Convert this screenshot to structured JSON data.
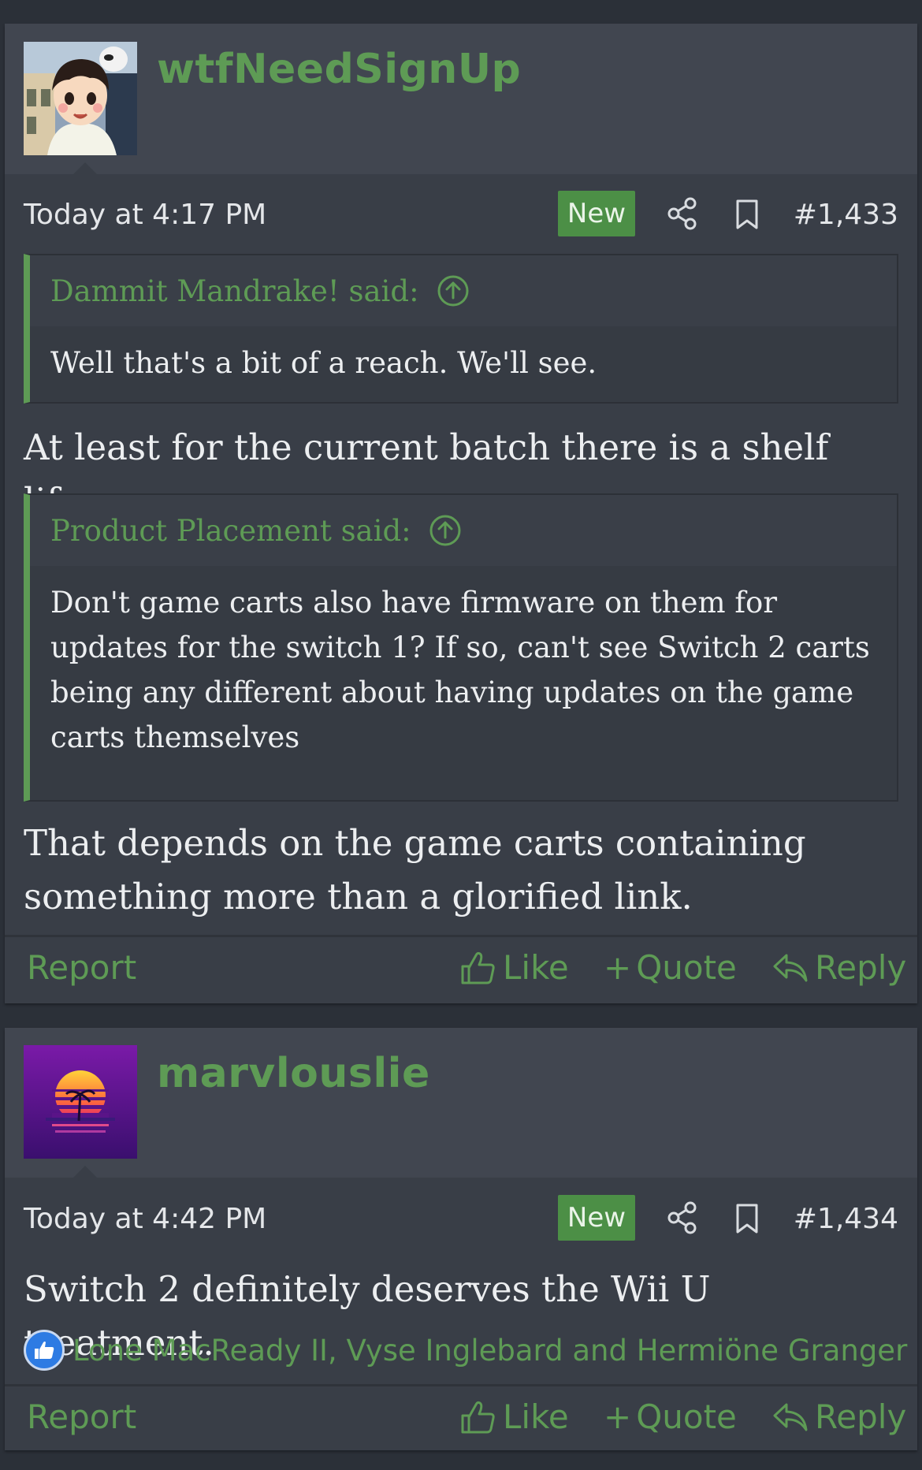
{
  "colors": {
    "background": "#2b3038",
    "card": "#393e47",
    "accent_green": "#5e9b55",
    "new_badge": "#4c8f46"
  },
  "posts": [
    {
      "username": "wtfNeedSignUp",
      "avatar_icon": "anime-boy-avatar",
      "date": "Today at 4:17 PM",
      "badge": "New",
      "number": "#1,433",
      "quotes": [
        {
          "author": "Dammit Mandrake! said:",
          "text": "Well that's a bit of a reach. We'll see."
        },
        {
          "author": "Product Placement said:",
          "text": "Don't game carts also have firmware on them for updates for the switch 1? If so, can't see Switch 2 carts being any different about having updates on the game carts themselves"
        }
      ],
      "replies": [
        "At least for the current batch there is a shelf life.",
        "That depends on the game carts containing something more than a glorified link."
      ],
      "actions": {
        "report": "Report",
        "like": "Like",
        "quote": "Quote",
        "reply": "Reply"
      }
    },
    {
      "username": "marvlouslie",
      "avatar_icon": "synthwave-sunset-avatar",
      "date": "Today at 4:42 PM",
      "badge": "New",
      "number": "#1,434",
      "body": "Switch 2 definitely deserves the Wii U treatment.",
      "reactions": "Lone MacReady II, Vyse Inglebard and Hermiöne Granger",
      "actions": {
        "report": "Report",
        "like": "Like",
        "quote": "Quote",
        "reply": "Reply"
      }
    }
  ]
}
